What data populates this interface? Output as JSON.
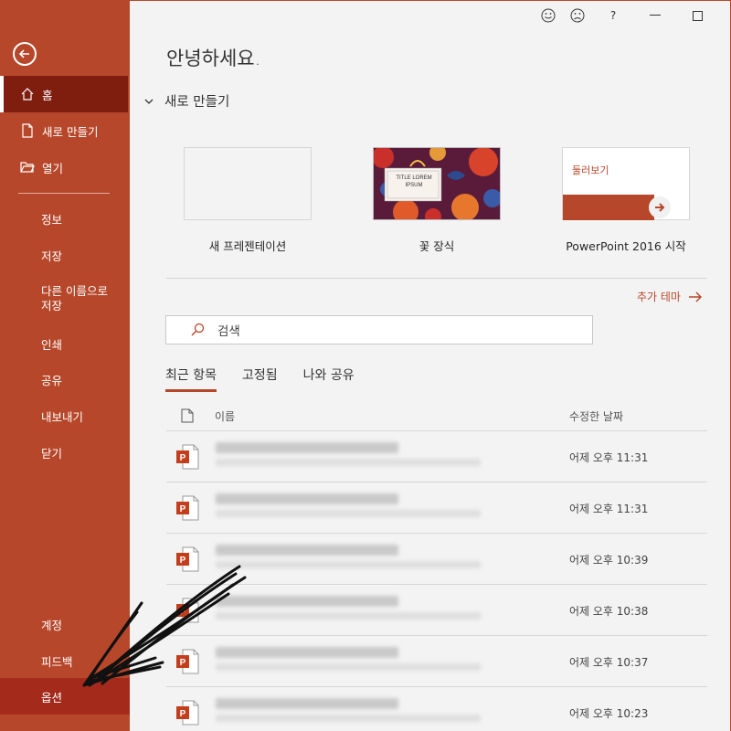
{
  "sidebar": {
    "home": "홈",
    "new": "새로 만들기",
    "open": "열기",
    "info": "정보",
    "save": "저장",
    "save_as_line1": "다른 이름으로",
    "save_as_line2": "저장",
    "print": "인쇄",
    "share": "공유",
    "export": "내보내기",
    "close": "닫기",
    "account": "계정",
    "feedback": "피드백",
    "options": "옵션"
  },
  "header": {
    "greeting": "안녕하세요.",
    "help": "?"
  },
  "new_section": {
    "title": "새로 만들기",
    "templates": [
      {
        "label": "새 프레젠테이션"
      },
      {
        "label": "꽃 장식",
        "thumb_title": "TITLE LOREM IPSUM"
      },
      {
        "label": "PowerPoint 2016 시작",
        "thumb_title": "둘러보기"
      }
    ],
    "more_themes": "추가 테마"
  },
  "search": {
    "placeholder": "검색"
  },
  "tabs": [
    "최근 항목",
    "고정됨",
    "나와 공유"
  ],
  "recent": {
    "col_name": "이름",
    "col_date": "수정한 날짜",
    "rows": [
      {
        "date": "어제 오후 11:31"
      },
      {
        "date": "어제 오후 11:31"
      },
      {
        "date": "어제 오후 10:39"
      },
      {
        "date": "어제 오후 10:38"
      },
      {
        "date": "어제 오후 10:37"
      },
      {
        "date": "어제 오후 10:23"
      }
    ]
  },
  "colors": {
    "accent": "#b7472a",
    "accent_dark": "#7f1d0f"
  }
}
